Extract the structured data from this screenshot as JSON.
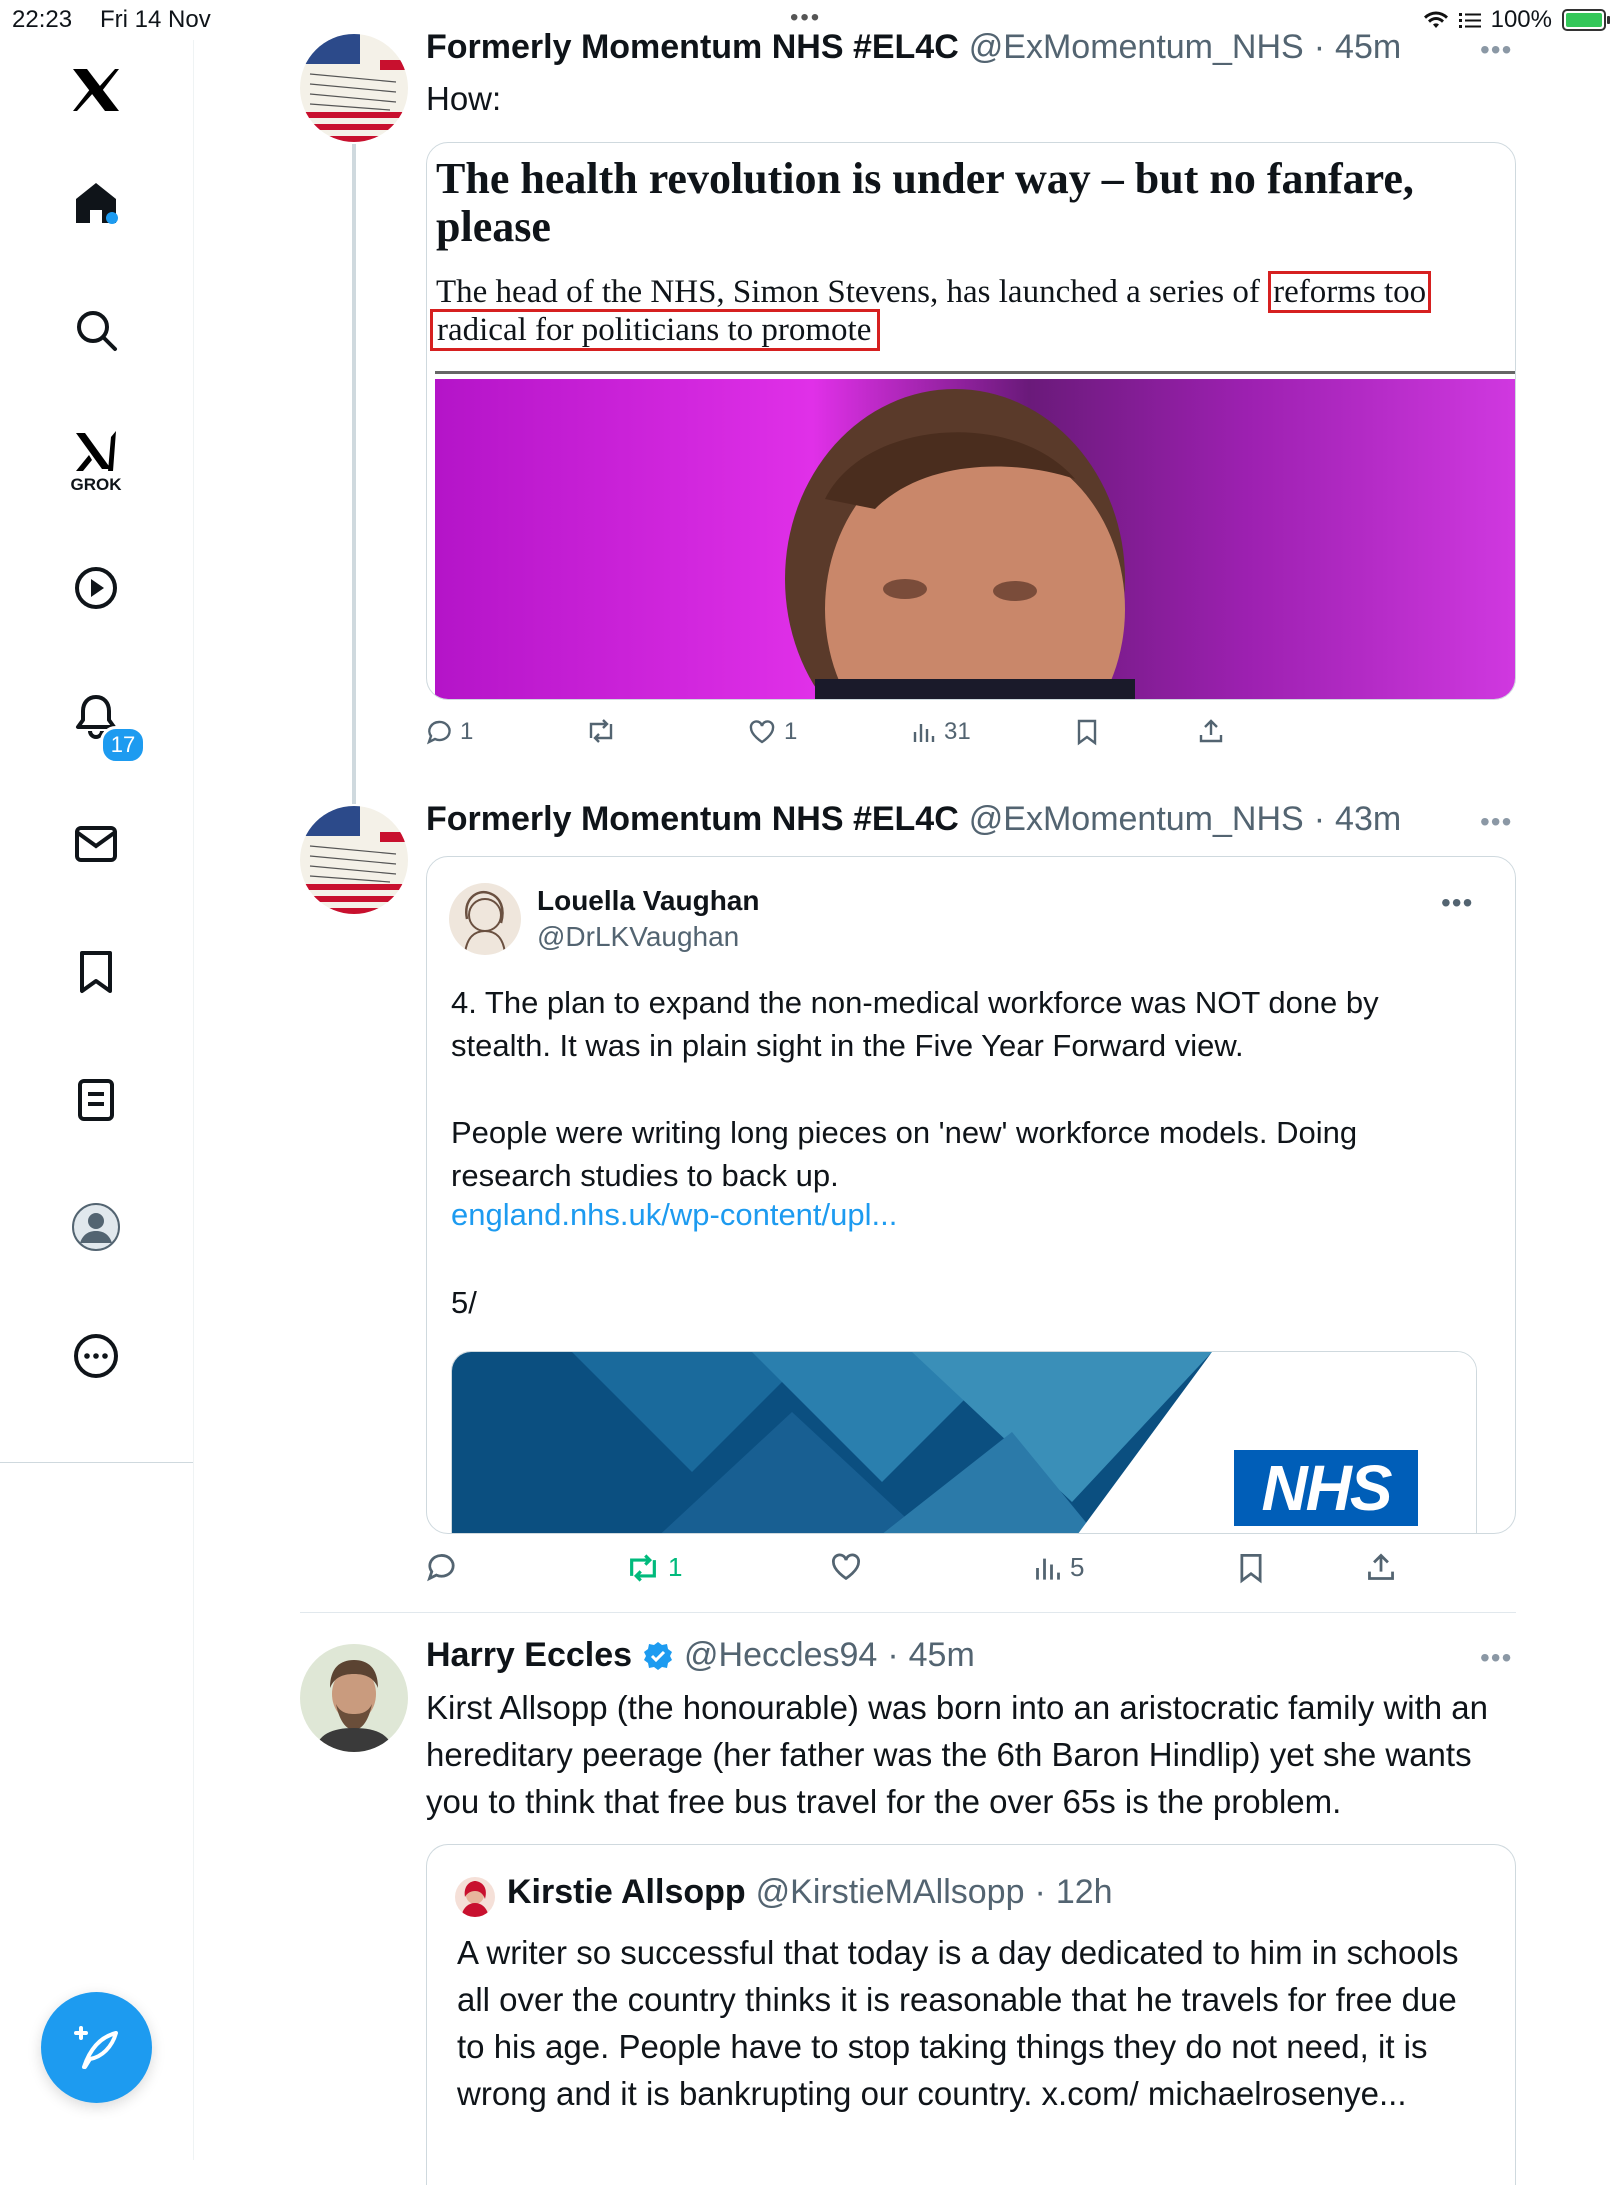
{
  "status_bar": {
    "time": "22:23",
    "date": "Fri 14 Nov",
    "battery": "100%"
  },
  "sidebar": {
    "grok_label": "GROK",
    "notification_count": "17"
  },
  "tweets": [
    {
      "name": "Formerly Momentum NHS #EL4C",
      "handle": "@ExMomentum_NHS",
      "time": "45m",
      "text": "How:",
      "article": {
        "headline": "The health revolution is under way – but no fanfare, please",
        "standfirst_a": "The head of the NHS, Simon Stevens, has launched a series of ",
        "standfirst_highlight_1": "reforms too",
        "standfirst_highlight_2": "radical for politicians to promote"
      },
      "stats": {
        "replies": "1",
        "reposts": "",
        "likes": "1",
        "views": "31"
      }
    },
    {
      "name": "Formerly Momentum NHS #EL4C",
      "handle": "@ExMomentum_NHS",
      "time": "43m",
      "quoted": {
        "name": "Louella Vaughan",
        "handle": "@DrLKVaughan",
        "para1": "4. The plan to expand the non-medical workforce was NOT done by stealth. It was in plain sight in the Five Year Forward view.",
        "para2": "People were writing long pieces on 'new' workforce models. Doing research studies to back up.",
        "link": "england.nhs.uk/wp-content/upl...",
        "counter": "5/",
        "nhs_logo": "NHS"
      },
      "stats": {
        "replies": "",
        "reposts": "1",
        "likes": "",
        "views": "5"
      }
    },
    {
      "name": "Harry Eccles",
      "handle": "@Heccles94",
      "time": "45m",
      "verified": true,
      "text": "Kirst Allsopp (the honourable) was born into an aristocratic family with an hereditary peerage (her father was the 6th Baron Hindlip) yet she wants you to think that free bus travel for the over 65s is the problem.",
      "quoted": {
        "name": "Kirstie Allsopp",
        "handle": "@KirstieMAllsopp",
        "time": "12h",
        "text": "A writer so successful that today is a day dedicated to him in schools all over the country thinks it is reasonable that he travels for free due to his age. People have to stop taking things they do not need, it is wrong and it is bankrupting our country. x.com/ michaelrosenye..."
      }
    }
  ],
  "colors": {
    "accent": "#1d9bf0",
    "repost_active": "#00ba7c",
    "highlight_box": "#d62020"
  }
}
